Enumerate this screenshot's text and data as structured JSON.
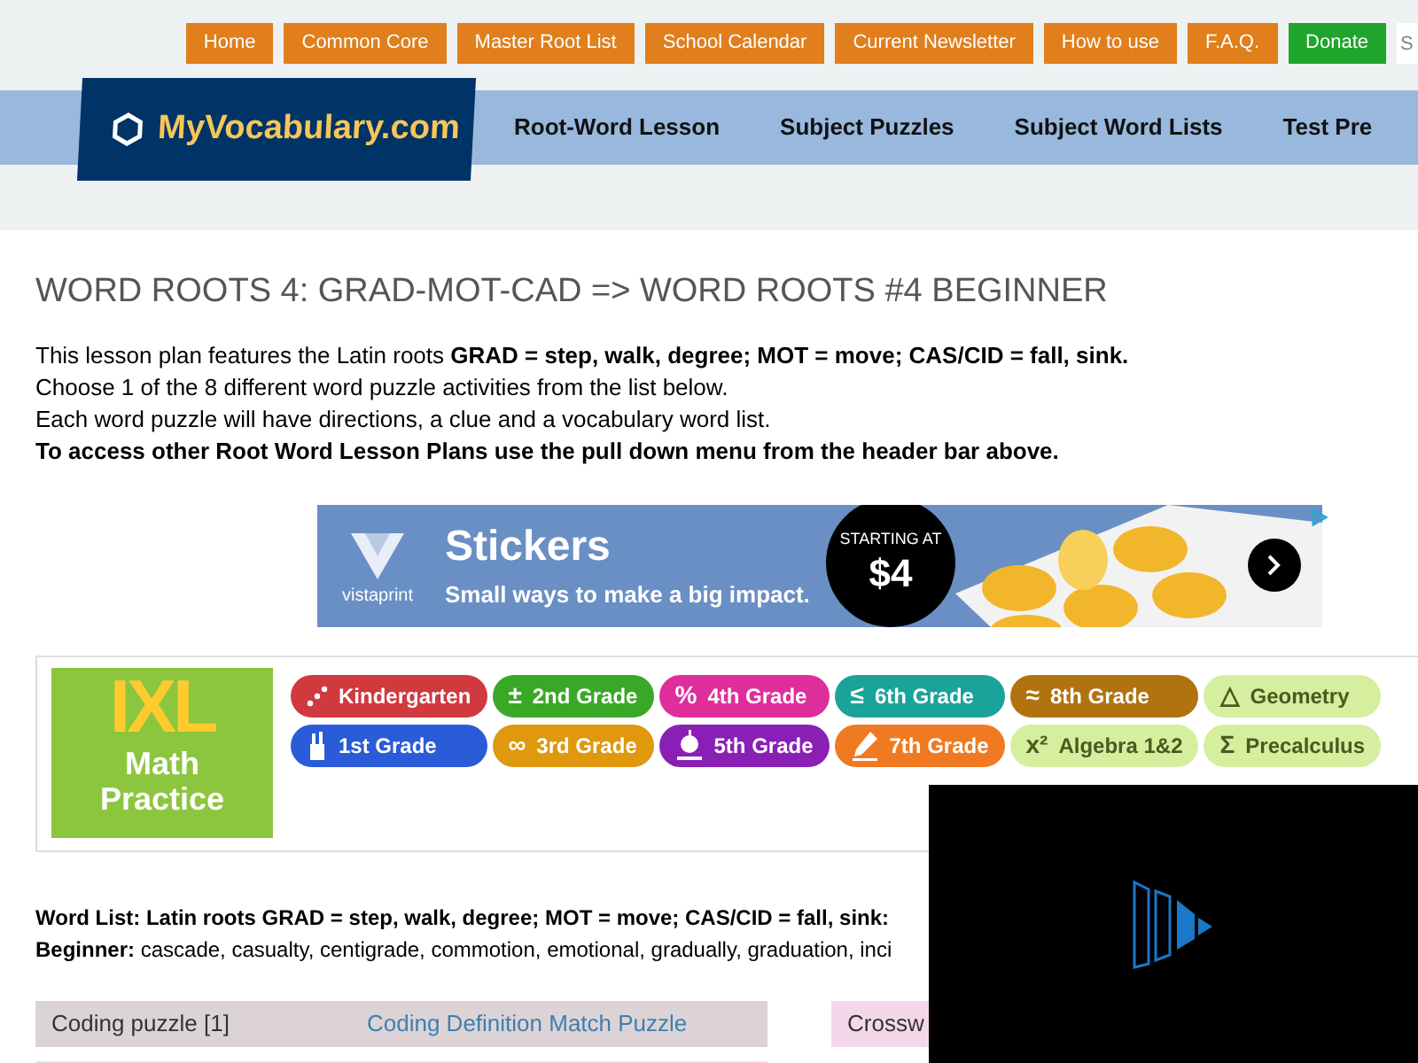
{
  "top_links": [
    {
      "label": "Home",
      "kind": "link"
    },
    {
      "label": "Common Core",
      "kind": "link"
    },
    {
      "label": "Master Root List",
      "kind": "link"
    },
    {
      "label": "School Calendar",
      "kind": "link"
    },
    {
      "label": "Current Newsletter",
      "kind": "link"
    },
    {
      "label": "How to use",
      "kind": "link"
    },
    {
      "label": "F.A.Q.",
      "kind": "link"
    },
    {
      "label": "Donate",
      "kind": "donate"
    }
  ],
  "search": {
    "placeholder": "S"
  },
  "logo": {
    "text": "MyVocabulary.com"
  },
  "nav": [
    "Root-Word Lesson",
    "Subject Puzzles",
    "Subject Word Lists",
    "Test Pre"
  ],
  "heading": "WORD ROOTS 4: GRAD-MOT-CAD => WORD ROOTS #4 BEGINNER",
  "intro": [
    {
      "text": "This lesson plan features the Latin roots **GRAD = step, walk, degree; MOT = move; CAS/CID = fall, sink.**",
      "bold": false
    },
    {
      "text": "Choose 1 of the 8 different word puzzle activities from the list below.",
      "bold": false
    },
    {
      "text": "Each word puzzle will have directions, a clue and a vocabulary word list.",
      "bold": false
    },
    {
      "text": "To access other Root Word Lesson Plans use the pull down menu from the header bar above.",
      "bold": true
    }
  ],
  "ad": {
    "brand": "vistaprint",
    "title": "Stickers",
    "tagline": "Small ways to make a big impact.",
    "price_label": "STARTING AT",
    "price": "$4"
  },
  "ixl": {
    "logo": "IXL",
    "subtitle": [
      "Math",
      "Practice"
    ],
    "grades": [
      {
        "label": "Kindergarten",
        "color": "#d0393e",
        "kind": "dots"
      },
      {
        "label": "2nd Grade",
        "color": "#3aa827",
        "kind": "symbol",
        "symbol": "±"
      },
      {
        "label": "4th Grade",
        "color": "#dd2e9c",
        "kind": "symbol",
        "symbol": "%"
      },
      {
        "label": "6th Grade",
        "color": "#1aa39a",
        "kind": "symbol",
        "symbol": "≤"
      },
      {
        "label": "8th Grade",
        "color": "#b0730f",
        "kind": "symbol",
        "symbol": "≈"
      },
      {
        "label": "Geometry",
        "color": "#d5ef9e",
        "kind": "symbol",
        "symbol": "△"
      },
      {
        "label": "1st Grade",
        "color": "#2a5bd8",
        "kind": "cup"
      },
      {
        "label": "3rd Grade",
        "color": "#e0980e",
        "kind": "symbol",
        "symbol": "∞"
      },
      {
        "label": "5th Grade",
        "color": "#8a1fb5",
        "kind": "apple"
      },
      {
        "label": "7th Grade",
        "color": "#f07a22",
        "kind": "pencil"
      },
      {
        "label": "Algebra 1&2",
        "color": "#d5ef9e",
        "kind": "symbol",
        "symbol": "x²"
      },
      {
        "label": "Precalculus",
        "color": "#d5ef9e",
        "kind": "symbol",
        "symbol": "Σ"
      }
    ]
  },
  "word_list": {
    "text": "Word List: Latin roots GRAD = step, walk, degree; MOT = move; CAS/CID = fall, sink:"
  },
  "beginner": {
    "text": "**Beginner:** cascade, casualty, centigrade, commotion, emotional, gradually, graduation, inci"
  },
  "puzzles": [
    {
      "name": "Coding puzzle [1]",
      "link": "Coding Definition Match Puzzle"
    }
  ],
  "puzzles_2": [
    {
      "name": "Crossw"
    }
  ]
}
